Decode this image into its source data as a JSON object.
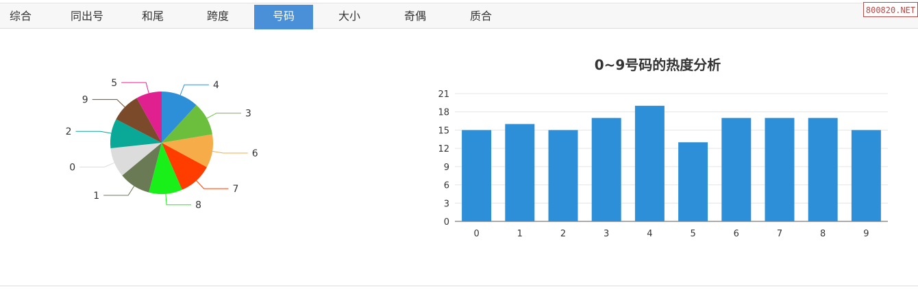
{
  "tabs": [
    {
      "label": "综合",
      "active": false
    },
    {
      "label": "同出号",
      "active": false
    },
    {
      "label": "和尾",
      "active": false
    },
    {
      "label": "跨度",
      "active": false
    },
    {
      "label": "号码",
      "active": true
    },
    {
      "label": "大小",
      "active": false
    },
    {
      "label": "奇偶",
      "active": false
    },
    {
      "label": "质合",
      "active": false
    }
  ],
  "watermark": "800820.NET",
  "chart_data": [
    {
      "type": "pie",
      "slices": [
        {
          "label": "4",
          "value": 19,
          "color": "#2e8fd9"
        },
        {
          "label": "3",
          "value": 17,
          "color": "#6cbf3c"
        },
        {
          "label": "6",
          "value": 17,
          "color": "#f7ac4a"
        },
        {
          "label": "7",
          "value": 17,
          "color": "#ff3d00"
        },
        {
          "label": "8",
          "value": 17,
          "color": "#19f019"
        },
        {
          "label": "1",
          "value": 16,
          "color": "#6a7a55"
        },
        {
          "label": "0",
          "value": 15,
          "color": "#dcdcdc"
        },
        {
          "label": "2",
          "value": 15,
          "color": "#0aa896"
        },
        {
          "label": "9",
          "value": 15,
          "color": "#7a4a2a"
        },
        {
          "label": "5",
          "value": 13,
          "color": "#e0208f"
        }
      ]
    },
    {
      "type": "bar",
      "title": "0~9号码的热度分析",
      "categories": [
        "0",
        "1",
        "2",
        "3",
        "4",
        "5",
        "6",
        "7",
        "8",
        "9"
      ],
      "values": [
        15,
        16,
        15,
        17,
        19,
        13,
        17,
        17,
        17,
        15
      ],
      "ylim": [
        0,
        21
      ],
      "yticks": [
        0,
        3,
        6,
        9,
        12,
        15,
        18,
        21
      ],
      "grid": true,
      "color": "#2e8fd9"
    }
  ]
}
